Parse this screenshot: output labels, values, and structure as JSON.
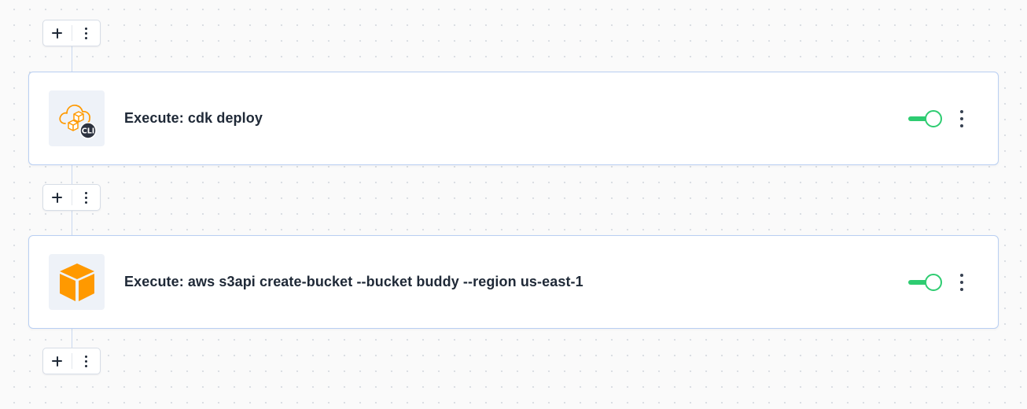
{
  "workflow": {
    "add_bars": [
      {
        "add_label": "+",
        "more_label": "⋮"
      },
      {
        "add_label": "+",
        "more_label": "⋮"
      },
      {
        "add_label": "+",
        "more_label": "⋮"
      }
    ],
    "steps": [
      {
        "title": "Execute: cdk deploy",
        "icon": "aws-cdk-cli-icon",
        "icon_badge": "CLI",
        "enabled": true
      },
      {
        "title": "Execute: aws s3api create-bucket --bucket buddy --region us-east-1",
        "icon": "aws-cube-icon",
        "enabled": true
      }
    ]
  },
  "colors": {
    "toggle_on": "#2ecc71",
    "card_border": "#b9cff2",
    "aws_orange": "#ff9900",
    "text": "#1f2937"
  }
}
